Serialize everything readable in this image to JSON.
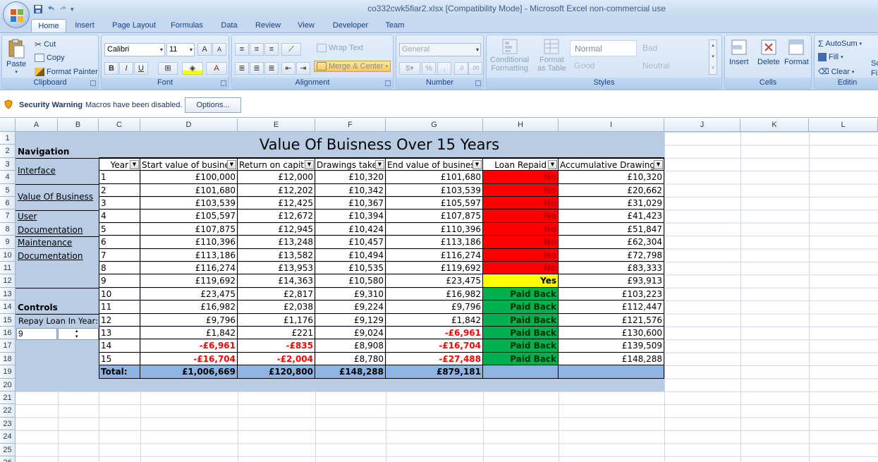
{
  "window": {
    "title": "co332cwk5fiar2.xlsx  [Compatibility Mode] - Microsoft Excel non-commercial use"
  },
  "tabs": [
    "Home",
    "Insert",
    "Page Layout",
    "Formulas",
    "Data",
    "Review",
    "View",
    "Developer",
    "Team"
  ],
  "ribbon": {
    "clipboard": {
      "paste": "Paste",
      "cut": "Cut",
      "copy": "Copy",
      "format_painter": "Format Painter",
      "label": "Clipboard"
    },
    "font": {
      "name": "Calibri",
      "size": "11",
      "label": "Font"
    },
    "alignment": {
      "wrap_text": "Wrap Text",
      "merge_center": "Merge & Center",
      "label": "Alignment"
    },
    "number": {
      "format": "General",
      "label": "Number"
    },
    "styles": {
      "conditional": "Conditional",
      "formatting": "Formatting",
      "format": "Format",
      "as_table": "as Table",
      "normal": "Normal",
      "bad": "Bad",
      "good": "Good",
      "neutral": "Neutral",
      "label": "Styles"
    },
    "cells": {
      "insert": "Insert",
      "delete": "Delete",
      "format": "Format",
      "label": "Cells"
    },
    "editing": {
      "autosum": "AutoSum",
      "fill": "Fill",
      "clear": "Clear",
      "label": "Editin",
      "sort": "So",
      "find": "Fi"
    }
  },
  "security": {
    "label": "Security Warning",
    "message": "Macros have been disabled.",
    "options": "Options..."
  },
  "columns": [
    "A",
    "B",
    "C",
    "D",
    "E",
    "F",
    "G",
    "H",
    "I",
    "J",
    "K",
    "L"
  ],
  "rows": [
    "1",
    "2",
    "3",
    "4",
    "5",
    "6",
    "7",
    "8",
    "9",
    "10",
    "11",
    "12",
    "13",
    "14",
    "15",
    "16",
    "17",
    "18",
    "19",
    "20",
    "21",
    "22",
    "23",
    "24",
    "25",
    "26"
  ],
  "sheet": {
    "title": "Value Of Buisness Over 15 Years",
    "nav": {
      "navigation": "Navigation",
      "interface": "Interface",
      "value_of_business": "Value Of Business",
      "user": "User",
      "documentation1": "Documentation",
      "maintenance": "Maintenance",
      "documentation2": "Documentation",
      "controls": "Controls",
      "repay_label": "Repay Loan In Year:",
      "repay_value": "9"
    },
    "headers": [
      "Year",
      "Start value of busine",
      "Return on capit",
      "Drawings take",
      "End value of busines",
      "Loan Repaid",
      "Accumulative Drawing"
    ],
    "rows": [
      {
        "year": "1",
        "start": "£100,000",
        "ret": "£12,000",
        "draw": "£10,320",
        "end": "£101,680",
        "loan": "No",
        "acc": "£10,320"
      },
      {
        "year": "2",
        "start": "£101,680",
        "ret": "£12,202",
        "draw": "£10,342",
        "end": "£103,539",
        "loan": "No",
        "acc": "£20,662"
      },
      {
        "year": "3",
        "start": "£103,539",
        "ret": "£12,425",
        "draw": "£10,367",
        "end": "£105,597",
        "loan": "No",
        "acc": "£31,029"
      },
      {
        "year": "4",
        "start": "£105,597",
        "ret": "£12,672",
        "draw": "£10,394",
        "end": "£107,875",
        "loan": "No",
        "acc": "£41,423"
      },
      {
        "year": "5",
        "start": "£107,875",
        "ret": "£12,945",
        "draw": "£10,424",
        "end": "£110,396",
        "loan": "No",
        "acc": "£51,847"
      },
      {
        "year": "6",
        "start": "£110,396",
        "ret": "£13,248",
        "draw": "£10,457",
        "end": "£113,186",
        "loan": "No",
        "acc": "£62,304"
      },
      {
        "year": "7",
        "start": "£113,186",
        "ret": "£13,582",
        "draw": "£10,494",
        "end": "£116,274",
        "loan": "No",
        "acc": "£72,798"
      },
      {
        "year": "8",
        "start": "£116,274",
        "ret": "£13,953",
        "draw": "£10,535",
        "end": "£119,692",
        "loan": "No",
        "acc": "£83,333"
      },
      {
        "year": "9",
        "start": "£119,692",
        "ret": "£14,363",
        "draw": "£10,580",
        "end": "£23,475",
        "loan": "Yes",
        "acc": "£93,913"
      },
      {
        "year": "10",
        "start": "£23,475",
        "ret": "£2,817",
        "draw": "£9,310",
        "end": "£16,982",
        "loan": "Paid Back",
        "acc": "£103,223"
      },
      {
        "year": "11",
        "start": "£16,982",
        "ret": "£2,038",
        "draw": "£9,224",
        "end": "£9,796",
        "loan": "Paid Back",
        "acc": "£112,447"
      },
      {
        "year": "12",
        "start": "£9,796",
        "ret": "£1,176",
        "draw": "£9,129",
        "end": "£1,842",
        "loan": "Paid Back",
        "acc": "£121,576"
      },
      {
        "year": "13",
        "start": "£1,842",
        "ret": "£221",
        "draw": "£9,024",
        "end": "-£6,961",
        "loan": "Paid Back",
        "acc": "£130,600"
      },
      {
        "year": "14",
        "start": "-£6,961",
        "ret": "-£835",
        "draw": "£8,908",
        "end": "-£16,704",
        "loan": "Paid Back",
        "acc": "£139,509"
      },
      {
        "year": "15",
        "start": "-£16,704",
        "ret": "-£2,004",
        "draw": "£8,780",
        "end": "-£27,488",
        "loan": "Paid Back",
        "acc": "£148,288"
      }
    ],
    "totals": {
      "label": "Total:",
      "start": "£1,006,669",
      "ret": "£120,800",
      "draw": "£148,288",
      "end": "£879,181"
    }
  },
  "colors": {
    "no": "#ff0000",
    "yes": "#ffff00",
    "paid": "#00b050",
    "nav_bg": "#b8cce4",
    "total_bg": "#8db4e2"
  }
}
